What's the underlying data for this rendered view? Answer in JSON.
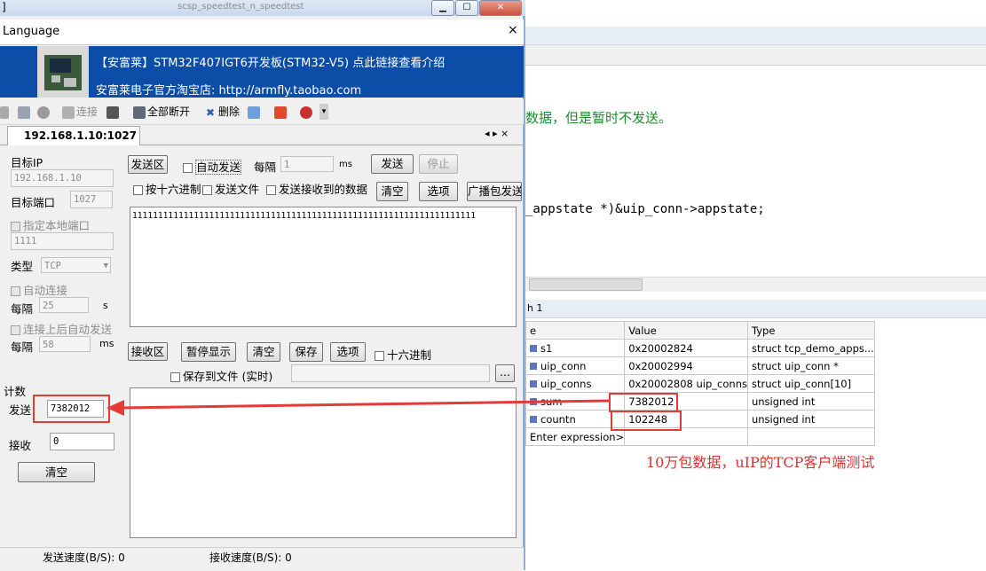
{
  "window": {
    "title_partial": "]",
    "bg_title_partial": "scsp_speedtest_n_speedtest"
  },
  "language_bar": {
    "label": "Language",
    "close": "×"
  },
  "banner": {
    "line1": "【安富莱】STM32F407IGT6开发板(STM32-V5) 点此链接查看介绍",
    "line2": "安富莱电子官方淘宝店: http://armfly.taobao.com"
  },
  "toolbar": {
    "connect": "连接",
    "disconnect_all": "全部断开",
    "delete": "删除"
  },
  "tab": {
    "label": "192.168.1.10:1027",
    "nav": "◂ ▸ ×"
  },
  "left_panel": {
    "target_ip_label": "目标IP",
    "target_ip": "192.168.1.10",
    "target_port_label": "目标端口",
    "target_port": "1027",
    "local_port_check": "指定本地端口",
    "local_port": "1111",
    "type_label": "类型",
    "type_value": "TCP",
    "auto_connect": "自动连接",
    "interval_label": "每隔",
    "interval_value": "25",
    "interval_unit": "s",
    "auto_send_after": "连接上后自动发送",
    "interval2_label": "每隔",
    "interval2_value": "58",
    "interval2_unit": "ms",
    "count_label": "计数",
    "send_label": "发送",
    "send_count": "7382012",
    "recv_label": "接收",
    "recv_count": "0",
    "clear_button": "清空"
  },
  "send_area": {
    "title": "发送区",
    "auto_send": "自动发送",
    "interval_label": "每隔",
    "interval_value": "1",
    "interval_unit": "ms",
    "send_button": "发送",
    "stop_button": "停止",
    "hex_send": "按十六进制",
    "send_file": "发送文件",
    "send_received": "发送接收到的数据",
    "clear_button": "清空",
    "options_button": "选项",
    "broadcast_button": "广播包发送",
    "content": "1111111111111111111111111111111111111111111111111111111111111111111"
  },
  "recv_area": {
    "title": "接收区",
    "pause_button": "暂停显示",
    "clear_button": "清空",
    "save_button": "保存",
    "options_button": "选项",
    "hex": "十六进制",
    "save_to_file": "保存到文件 (实时)",
    "browse": "..."
  },
  "status": {
    "send_speed": "发送速度(B/S): 0",
    "recv_speed": "接收速度(B/S): 0"
  },
  "editor": {
    "comment_line": "数据，但是暂时不发送。",
    "code_line": "_appstate *)&uip_conn->appstate;"
  },
  "watch": {
    "title": "h 1",
    "columns": [
      "e",
      "Value",
      "Type"
    ],
    "rows": [
      {
        "name": "s1",
        "value": "0x20002824",
        "type": "struct tcp_demo_apps..."
      },
      {
        "name": "uip_conn",
        "value": "0x20002994",
        "type": "struct uip_conn *"
      },
      {
        "name": "uip_conns",
        "value": "0x20002808 uip_conns",
        "type": "struct uip_conn[10]"
      },
      {
        "name": "sum",
        "value": "7382012",
        "type": "unsigned int"
      },
      {
        "name": "countn",
        "value": "102248",
        "type": "unsigned int"
      },
      {
        "name": "Enter expression>",
        "value": "",
        "type": ""
      }
    ],
    "annotation": "10万包数据，uIP的TCP客户端测试"
  },
  "colors": {
    "accent_red": "#e53a3a",
    "banner_blue": "#0c4ea7",
    "comment_green": "#1c8c2d"
  }
}
